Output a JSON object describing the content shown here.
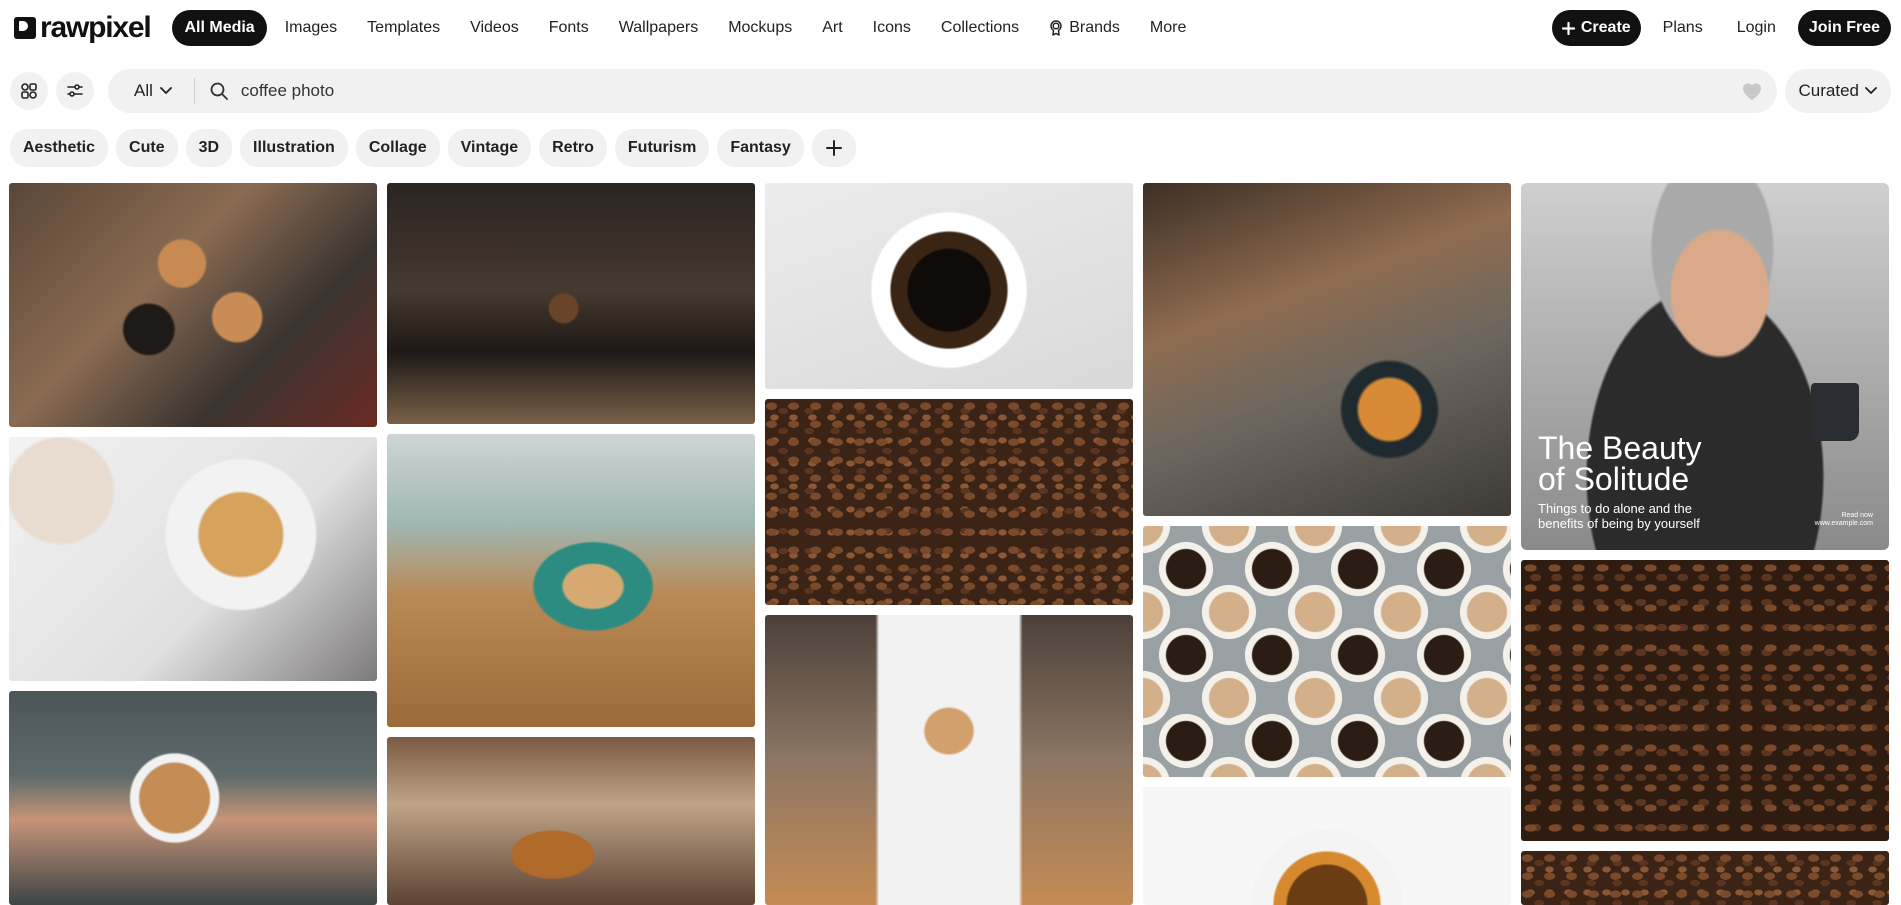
{
  "brand": {
    "name": "rawpixel"
  },
  "nav": {
    "links": [
      "All Media",
      "Images",
      "Templates",
      "Videos",
      "Fonts",
      "Wallpapers",
      "Mockups",
      "Art",
      "Icons",
      "Collections",
      "Brands",
      "More"
    ],
    "active": "All Media"
  },
  "actions": {
    "create": "Create",
    "plans": "Plans",
    "login": "Login",
    "join": "Join Free"
  },
  "search": {
    "scope": "All",
    "query": "coffee photo",
    "sort": "Curated"
  },
  "chips": [
    "Aesthetic",
    "Cute",
    "3D",
    "Illustration",
    "Collage",
    "Vintage",
    "Retro",
    "Futurism",
    "Fantasy"
  ],
  "promo": {
    "title_line1": "The Beauty",
    "title_line2": "of Solitude",
    "subtitle_line1": "Things to do alone and the",
    "subtitle_line2": "benefits of being by yourself",
    "read_now": "Read now",
    "url": "www.example.com"
  },
  "colors": {
    "primary": "#111111",
    "surface": "#f1f1f1"
  },
  "icons": {
    "grid_view": "grid-icon",
    "filters": "sliders-icon",
    "search": "search-icon",
    "heart": "heart-icon",
    "brands": "badge-icon",
    "add_chip": "plus-icon"
  }
}
